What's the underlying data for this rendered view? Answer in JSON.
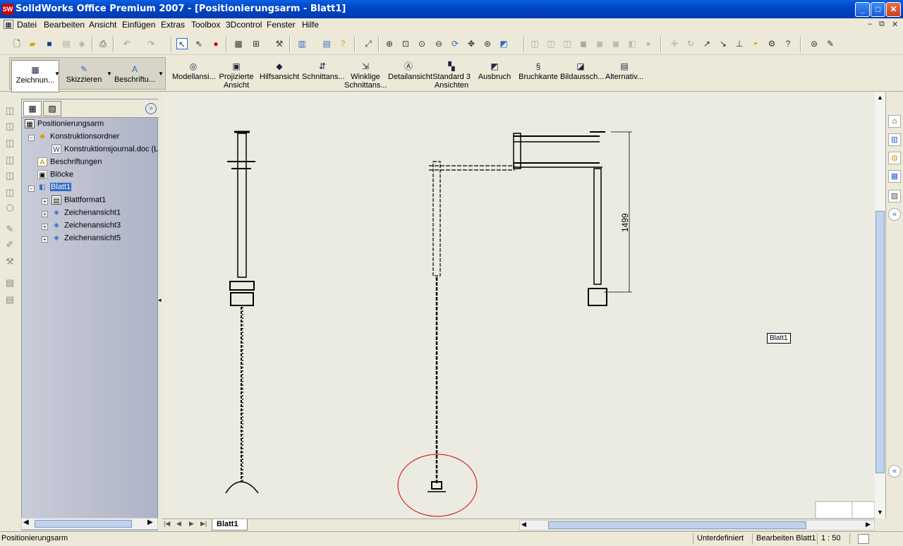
{
  "window": {
    "title": "SolidWorks Office Premium 2007 - [Positionierungsarm - Blatt1]",
    "app_icon": "SW",
    "minimize": "_",
    "maximize": "□",
    "close": "✕"
  },
  "menu": {
    "items": [
      "Datei",
      "Bearbeiten",
      "Ansicht",
      "Einfügen",
      "Extras",
      "Toolbox",
      "3Dcontrol",
      "Fenster",
      "Hilfe"
    ]
  },
  "command_manager": {
    "left_tabs": [
      "Zeichnun...",
      "Skizzieren",
      "Beschriftu..."
    ],
    "commands": [
      {
        "label": "Modellansi...",
        "icon": "model-view-icon"
      },
      {
        "label": "Projizierte Ansicht",
        "icon": "projected-view-icon"
      },
      {
        "label": "Hilfsansicht",
        "icon": "auxiliary-view-icon"
      },
      {
        "label": "Schnittans...",
        "icon": "section-view-icon"
      },
      {
        "label": "Winklige Schnittans...",
        "icon": "aligned-section-icon"
      },
      {
        "label": "Detailansicht",
        "icon": "detail-view-icon"
      },
      {
        "label": "Standard 3 Ansichten",
        "icon": "standard-3-view-icon"
      },
      {
        "label": "Ausbruch",
        "icon": "broken-out-icon"
      },
      {
        "label": "Bruchkante",
        "icon": "break-icon"
      },
      {
        "label": "Bildaussch...",
        "icon": "crop-view-icon"
      },
      {
        "label": "Alternativ...",
        "icon": "alternate-position-icon"
      }
    ]
  },
  "feature_manager": {
    "root": "Positionierungsarm",
    "items": [
      {
        "label": "Konstruktionsordner",
        "icon": "design-folder-icon"
      },
      {
        "label": "Konstruktionsjournal.doc (L",
        "icon": "word-doc-icon"
      },
      {
        "label": "Beschriftungen",
        "icon": "annotations-icon"
      },
      {
        "label": "Blöcke",
        "icon": "blocks-icon"
      },
      {
        "label": "Blatt1",
        "icon": "sheet-icon"
      },
      {
        "label": "Blattformat1",
        "icon": "sheet-format-icon"
      },
      {
        "label": "Zeichenansicht1",
        "icon": "drawing-view-icon"
      },
      {
        "label": "Zeichenansicht3",
        "icon": "drawing-view-icon"
      },
      {
        "label": "Zeichenansicht5",
        "icon": "drawing-view-icon"
      }
    ]
  },
  "canvas": {
    "dimension": "1499",
    "sheet_tag": "Blatt1"
  },
  "sheet_tabs": {
    "active": "Blatt1"
  },
  "status": {
    "left": "Positionierungsarm",
    "state": "Unterdefiniert",
    "editing": "Bearbeiten Blatt1",
    "scale": "1 : 50"
  },
  "colors": {
    "titlebar": "#0046c7",
    "selection": "#316ac5",
    "detail_circle": "#cc0000",
    "canvas": "#ecebe2"
  }
}
